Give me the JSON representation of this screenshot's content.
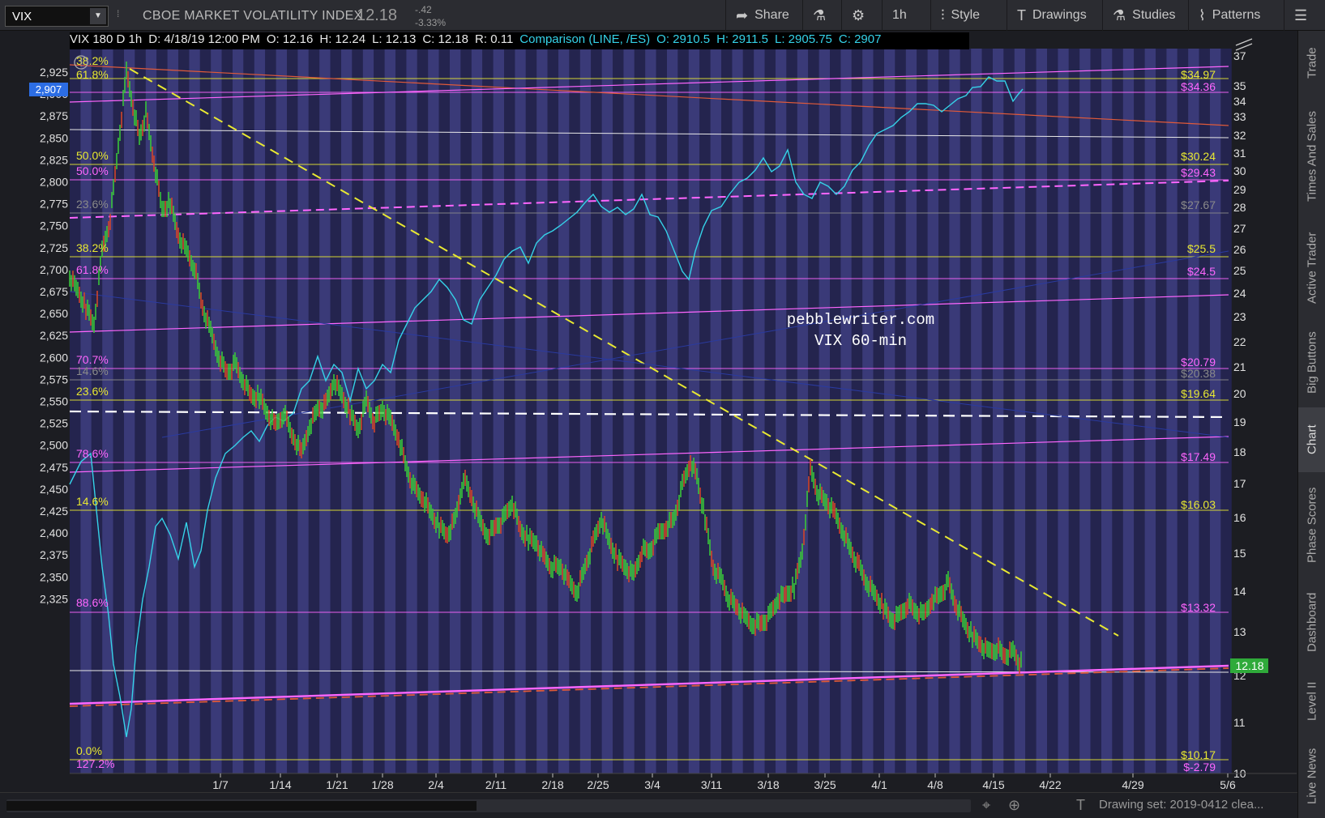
{
  "toolbar": {
    "symbol": "VIX",
    "name": "CBOE MARKET VOLATILITY INDEX",
    "price": "12.18",
    "change": "-.42",
    "change_pct": "-3.33%",
    "share": "Share",
    "timeframe": "1h",
    "style": "Style",
    "drawings": "Drawings",
    "studies": "Studies",
    "patterns": "Patterns"
  },
  "infobar": {
    "label": "VIX 180 D 1h",
    "date": "D: 4/18/19 12:00 PM",
    "open": "O: 12.16",
    "high": "H: 12.24",
    "low": "L: 12.13",
    "close": "C: 12.18",
    "range": "R: 0.11",
    "comparison": "Comparison (LINE, /ES)",
    "c_open": "O: 2910.5",
    "c_high": "H: 2911.5",
    "c_low": "L: 2905.75",
    "c_close": "C: 2907"
  },
  "chart": {
    "watermark1": "pebblewriter.com",
    "watermark2": "VIX 60-min",
    "left_axis_ticks": [
      "2,925",
      "2,900",
      "2,875",
      "2,850",
      "2,825",
      "2,800",
      "2,775",
      "2,750",
      "2,725",
      "2,700",
      "2,675",
      "2,650",
      "2,625",
      "2,600",
      "2,575",
      "2,550",
      "2,525",
      "2,500",
      "2,475",
      "2,450",
      "2,425",
      "2,400",
      "2,375",
      "2,350",
      "2,325"
    ],
    "right_axis_ticks": [
      "37",
      "35",
      "34",
      "33",
      "32",
      "31",
      "30",
      "29",
      "28",
      "27",
      "26",
      "25",
      "24",
      "23",
      "22",
      "21",
      "20",
      "19",
      "18",
      "17",
      "16",
      "15",
      "14",
      "13",
      "12",
      "11",
      "10"
    ],
    "x_ticks": [
      "1/7",
      "1/14",
      "1/21",
      "1/28",
      "2/4",
      "2/11",
      "2/18",
      "2/25",
      "3/4",
      "3/11",
      "3/18",
      "3/25",
      "4/1",
      "4/8",
      "4/15",
      "4/22",
      "4/29",
      "5/6"
    ],
    "current_es": "2,907",
    "current_vix": "12.18",
    "left_fib_labels": [
      {
        "text": "61.8%",
        "color": "yellow"
      },
      {
        "text": "38.2%",
        "color": "yellow"
      },
      {
        "text": "50.0%",
        "color": "yellow"
      },
      {
        "text": "50.0%",
        "color": "magenta"
      },
      {
        "text": "23.6%",
        "color": "gray"
      },
      {
        "text": "38.2%",
        "color": "yellow"
      },
      {
        "text": "61.8%",
        "color": "magenta"
      },
      {
        "text": "70.7%",
        "color": "magenta"
      },
      {
        "text": "14.6%",
        "color": "gray"
      },
      {
        "text": "23.6%",
        "color": "yellow"
      },
      {
        "text": "78.6%",
        "color": "magenta"
      },
      {
        "text": "14.6%",
        "color": "yellow"
      },
      {
        "text": "88.6%",
        "color": "magenta"
      },
      {
        "text": "0.0%",
        "color": "yellow"
      },
      {
        "text": "127.2%",
        "color": "magenta"
      }
    ],
    "right_price_labels": [
      {
        "text": "$34.97",
        "color": "yellow"
      },
      {
        "text": "$34.36",
        "color": "magenta"
      },
      {
        "text": "$30.24",
        "color": "yellow"
      },
      {
        "text": "$29.43",
        "color": "magenta"
      },
      {
        "text": "$27.67",
        "color": "gray"
      },
      {
        "text": "$25.5",
        "color": "yellow"
      },
      {
        "text": "$24.5",
        "color": "magenta"
      },
      {
        "text": "$20.79",
        "color": "magenta"
      },
      {
        "text": "$20.38",
        "color": "gray"
      },
      {
        "text": "$19.64",
        "color": "yellow"
      },
      {
        "text": "$17.49",
        "color": "magenta"
      },
      {
        "text": "$16.03",
        "color": "yellow"
      },
      {
        "text": "$13.32",
        "color": "magenta"
      },
      {
        "text": "$10.17",
        "color": "yellow"
      },
      {
        "text": "$-2.79",
        "color": "magenta"
      }
    ],
    "colors": {
      "yellow": "#e8e832",
      "magenta": "#ff66ff",
      "gray": "#8a8a8a",
      "cyan": "#35d2e8",
      "band_a": "#3a3a78",
      "band_b": "#24244e",
      "up": "#39c43a",
      "down": "#d2452a"
    }
  },
  "rightbar_tabs": [
    "Trade",
    "Times And Sales",
    "Active Trader",
    "Big Buttons",
    "Chart",
    "Phase Scores",
    "Dashboard",
    "Level II",
    "Live News"
  ],
  "bottombar": {
    "drawing_set": "Drawing set: 2019-0412 clea..."
  }
}
